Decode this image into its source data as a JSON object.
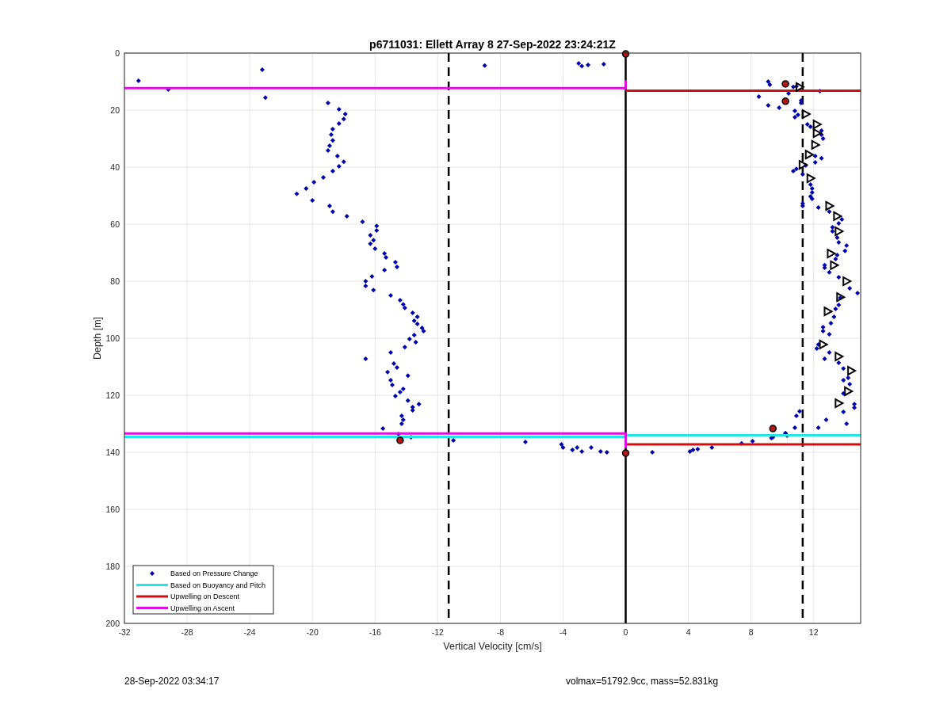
{
  "figure": {
    "chart_data": {
      "type": "scatter",
      "title": "p6711031: Ellett Array 8 27-Sep-2022 23:24:21Z",
      "xlabel": "Vertical Velocity [cm/s]",
      "ylabel": "Depth [m]",
      "xlim": [
        -32,
        15
      ],
      "ylim": [
        200,
        0
      ],
      "xticks": [
        -32,
        -28,
        -24,
        -20,
        -16,
        -12,
        -8,
        -4,
        0,
        4,
        8,
        12
      ],
      "yticks": [
        0,
        20,
        40,
        60,
        80,
        100,
        120,
        140,
        160,
        180,
        200
      ],
      "series": [
        {
          "name": "Based on Pressure Change",
          "type": "scatter",
          "marker": "diamond",
          "color": "#0000aa",
          "x": [
            -31.1,
            -29.2,
            -23.2,
            -23.0,
            -19.0,
            -18.3,
            -17.9,
            -18.0,
            -18.3,
            -18.7,
            -18.8,
            -18.7,
            -18.9,
            -19.0,
            -18.4,
            -18.0,
            -18.3,
            -18.7,
            -19.3,
            -19.9,
            -20.4,
            -21.0,
            -20.0,
            -18.9,
            -18.7,
            -17.8,
            -16.8,
            -15.9,
            -15.9,
            -16.3,
            -16.1,
            -16.3,
            -16.0,
            -15.4,
            -15.3,
            -14.7,
            -14.6,
            -15.4,
            -16.2,
            -16.6,
            -16.6,
            -16.1,
            -15.0,
            -14.4,
            -14.2,
            -14.1,
            -13.6,
            -13.3,
            -13.5,
            -13.3,
            -13.0,
            -12.9,
            -13.5,
            -13.8,
            -13.4,
            -14.1,
            -15.0,
            -16.6,
            -14.8,
            -14.6,
            -15.2,
            -13.9,
            -15.0,
            -14.9,
            -14.2,
            -14.4,
            -14.7,
            -13.9,
            -13.2,
            -13.6,
            -13.6,
            -14.3,
            -14.2,
            -14.3,
            -15.5,
            -14.5,
            -13.7,
            -9.0,
            -3.0,
            -2.8,
            -2.4,
            -1.4,
            -11.0,
            -6.4,
            -4.1,
            -4.0,
            -3.4,
            -3.1,
            -2.8,
            -2.2,
            -1.6,
            -1.2,
            1.7,
            4.3,
            4.6,
            4.1,
            5.5,
            7.4,
            8.1,
            9.4,
            10.2,
            10.8,
            11.1,
            9.1,
            9.2,
            10.7,
            10.9,
            8.5,
            10.4,
            12.4,
            9.1,
            9.8,
            11.2,
            11.2,
            10.8,
            10.8,
            11.0,
            11.6,
            11.8,
            12.5,
            12.5,
            12.6,
            12.1,
            12.5,
            12.1,
            10.7,
            10.9,
            11.5,
            11.3,
            11.8,
            11.9,
            11.9,
            11.8,
            11.9,
            11.3,
            11.3,
            12.3,
            13.0,
            13.6,
            13.8,
            13.2,
            13.2,
            13.5,
            13.6,
            14.1,
            14.0,
            13.5,
            13.4,
            12.7,
            12.7,
            13.0,
            13.6,
            14.3,
            14.8,
            13.7,
            13.6,
            13.4,
            13.3,
            13.1,
            12.6,
            12.6,
            13.0,
            12.3,
            12.2,
            13.0,
            12.7,
            13.6,
            13.9,
            14.2,
            13.9,
            14.3,
            13.9,
            14.6,
            14.6,
            13.9,
            10.9,
            12.8,
            14.1,
            12.3,
            10.2,
            9.3,
            10.3
          ],
          "values": [
            9.7,
            12.8,
            5.8,
            15.6,
            17.5,
            19.7,
            21.4,
            23.1,
            24.7,
            26.7,
            28.6,
            30.6,
            32.5,
            34.2,
            36.1,
            38.1,
            39.7,
            41.4,
            43.6,
            45.3,
            47.5,
            49.4,
            51.7,
            53.6,
            55.6,
            57.2,
            59.2,
            60.6,
            62.2,
            63.9,
            65.6,
            66.9,
            68.6,
            70.3,
            71.7,
            73.3,
            75.0,
            76.1,
            78.3,
            80.0,
            81.7,
            83.1,
            85.0,
            86.7,
            88.1,
            89.4,
            91.1,
            92.5,
            93.9,
            95.0,
            96.4,
            97.5,
            98.9,
            100.3,
            101.4,
            103.1,
            105.0,
            107.2,
            108.9,
            110.3,
            111.9,
            113.1,
            114.7,
            116.4,
            117.8,
            118.9,
            120.3,
            121.9,
            123.1,
            124.2,
            125.3,
            127.2,
            128.6,
            130.0,
            131.7,
            133.6,
            134.7,
            4.4,
            3.6,
            4.6,
            4.2,
            3.9,
            135.8,
            136.4,
            137.2,
            138.3,
            139.2,
            138.3,
            139.7,
            138.3,
            139.7,
            140.0,
            140.0,
            139.2,
            138.9,
            139.7,
            138.3,
            136.9,
            136.1,
            134.7,
            133.3,
            131.4,
            125.6,
            10.0,
            11.1,
            11.9,
            11.7,
            15.3,
            14.2,
            13.3,
            18.3,
            19.2,
            16.7,
            17.5,
            20.3,
            22.5,
            21.7,
            25.0,
            25.8,
            27.2,
            28.6,
            30.0,
            36.1,
            36.9,
            38.3,
            41.4,
            40.6,
            39.4,
            42.5,
            46.1,
            47.5,
            48.9,
            50.3,
            51.1,
            52.8,
            53.6,
            54.2,
            55.6,
            59.7,
            58.3,
            61.1,
            62.5,
            64.7,
            66.4,
            67.5,
            69.4,
            70.8,
            72.2,
            74.4,
            75.3,
            76.9,
            78.6,
            82.5,
            84.2,
            85.8,
            88.3,
            89.7,
            92.5,
            94.7,
            96.1,
            97.5,
            98.6,
            102.2,
            103.6,
            105.0,
            107.2,
            108.6,
            110.6,
            113.9,
            114.7,
            116.1,
            119.4,
            123.1,
            124.4,
            125.8,
            127.2,
            128.6,
            130.0,
            131.4,
            133.3,
            135.0,
            134.2
          ]
        },
        {
          "name": "Based on Buoyancy and Pitch",
          "type": "line",
          "color": "#22e5e5",
          "x": [
            -32,
            0
          ],
          "values": [
            134.6,
            134.6
          ]
        },
        {
          "type": "line",
          "color": "#22e5e5",
          "x": [
            0,
            15
          ],
          "values": [
            134.0,
            134.0
          ]
        },
        {
          "name": "Upwelling on Descent",
          "type": "line",
          "color": "#cc1111",
          "x": [
            0,
            15
          ],
          "values": [
            13.2,
            13.2
          ]
        },
        {
          "type": "line",
          "color": "#cc1111",
          "x": [
            0,
            15
          ],
          "values": [
            137.2,
            137.2
          ]
        },
        {
          "name": "Upwelling on Ascent",
          "type": "line",
          "color": "#dd11dd",
          "x": [
            -32,
            0,
            0
          ],
          "values": [
            12.3,
            12.3,
            9.5
          ]
        },
        {
          "type": "line",
          "color": "#dd11dd",
          "x": [
            -32,
            0,
            0
          ],
          "values": [
            133.4,
            133.4,
            138.5
          ]
        },
        {
          "type": "scatter",
          "marker": "triangle",
          "color": "#000000",
          "x": [
            11.1,
            11.5,
            12.2,
            12.2,
            12.1,
            11.7,
            11.3,
            11.8,
            13.0,
            13.5,
            13.6,
            13.1,
            13.3,
            14.1,
            13.7,
            12.9,
            12.6,
            13.6,
            14.4,
            14.2,
            13.6
          ],
          "values": [
            11.9,
            21.4,
            25.0,
            28.1,
            32.2,
            35.6,
            39.2,
            43.9,
            53.6,
            57.2,
            62.5,
            70.3,
            74.4,
            80.0,
            85.6,
            90.6,
            102.2,
            106.4,
            111.4,
            118.6,
            122.8
          ]
        },
        {
          "type": "scatter",
          "marker": "circle",
          "color": "#b01818",
          "x": [
            10.2,
            10.2,
            9.4,
            -14.4,
            0,
            0
          ],
          "values": [
            10.8,
            16.9,
            131.7,
            135.8,
            140.3,
            0.3
          ]
        }
      ],
      "ref_lines": [
        {
          "axis": "x",
          "value": -11.3
        },
        {
          "axis": "x",
          "value": 11.3
        },
        {
          "axis": "x",
          "value": 0
        }
      ],
      "grid": true,
      "legend": true
    },
    "footer_left": "28-Sep-2022 03:34:17",
    "footer_right": "volmax=51792.9cc, mass=52.831kg"
  }
}
